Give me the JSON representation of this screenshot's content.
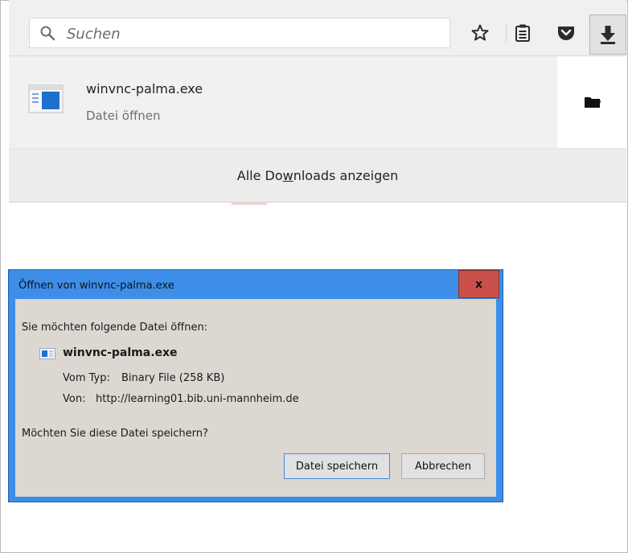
{
  "toolbar": {
    "search_placeholder": "Suchen"
  },
  "download": {
    "filename": "winvnc-palma.exe",
    "status": "Datei öffnen",
    "show_all_pre": "Alle Do",
    "show_all_accel": "w",
    "show_all_post": "nloads anzeigen"
  },
  "dialog": {
    "title": "Öffnen von winvnc-palma.exe",
    "close_label": "x",
    "prompt": "Sie möchten folgende Datei öffnen:",
    "filename": "winvnc-palma.exe",
    "type_label": "Vom Typ:",
    "type_value": "Binary File (258 KB)",
    "from_label": "Von:",
    "from_value": "http://learning01.bib.uni-mannheim.de",
    "question": "Möchten Sie diese Datei speichern?",
    "save_label": "Datei speichern",
    "cancel_label": "Abbrechen"
  },
  "colors": {
    "dialog_frame": "#3d8ee8",
    "dialog_body": "#dcd7d1",
    "close_button": "#c9504a",
    "accent_blue": "#1e6fd0"
  }
}
